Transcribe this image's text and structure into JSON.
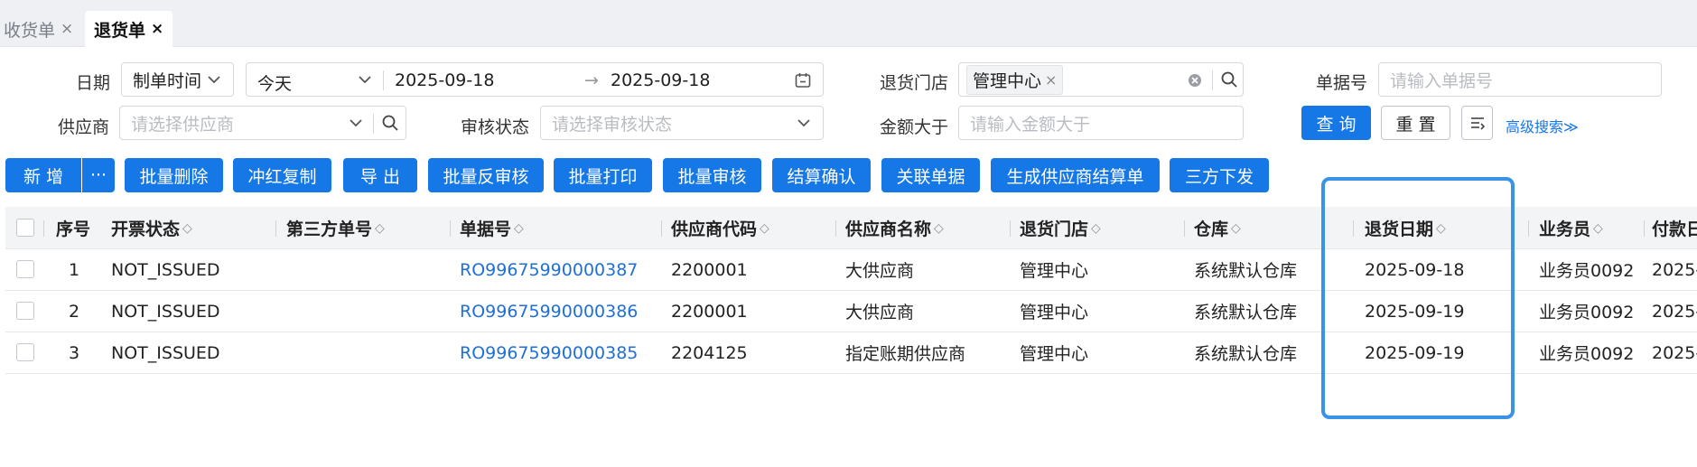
{
  "tabs": [
    {
      "label": "收货单",
      "close": "×"
    },
    {
      "label": "退货单",
      "close": "×"
    }
  ],
  "filters": {
    "date_label": "日期",
    "date_type": "制单时间",
    "date_preset": "今天",
    "date_start": "2025-09-18",
    "date_arrow": "→",
    "date_end": "2025-09-18",
    "store_label": "退货门店",
    "store_tag": "管理中心",
    "store_tag_close": "×",
    "doc_no_label": "单据号",
    "doc_no_placeholder": "请输入单据号",
    "supplier_label": "供应商",
    "supplier_placeholder": "请选择供应商",
    "audit_label": "审核状态",
    "audit_placeholder": "请选择审核状态",
    "amount_label": "金额大于",
    "amount_placeholder": "请输入金额大于",
    "query_label": "查 询",
    "reset_label": "重 置",
    "advanced_label": "高级搜索≫"
  },
  "toolbar": {
    "add": "新 增",
    "more": "···",
    "buttons": [
      "批量删除",
      "冲红复制",
      "导 出",
      "批量反审核",
      "批量打印",
      "批量审核",
      "结算确认",
      "关联单据",
      "生成供应商结算单",
      "三方下发"
    ]
  },
  "table": {
    "headers": [
      "序号",
      "开票状态",
      "第三方单号",
      "单据号",
      "供应商代码",
      "供应商名称",
      "退货门店",
      "仓库",
      "退货日期",
      "业务员",
      "付款日"
    ],
    "sort_icon": "◇",
    "rows": [
      {
        "no": "1",
        "invoice": "NOT_ISSUED",
        "third": "",
        "doc": "RO99675990000387",
        "code": "2200001",
        "name": "大供应商",
        "store": "管理中心",
        "wh": "系统默认仓库",
        "date": "2025-09-18",
        "staff": "业务员0092",
        "pay": "2025-"
      },
      {
        "no": "2",
        "invoice": "NOT_ISSUED",
        "third": "",
        "doc": "RO99675990000386",
        "code": "2200001",
        "name": "大供应商",
        "store": "管理中心",
        "wh": "系统默认仓库",
        "date": "2025-09-19",
        "staff": "业务员0092",
        "pay": "2025-"
      },
      {
        "no": "3",
        "invoice": "NOT_ISSUED",
        "third": "",
        "doc": "RO99675990000385",
        "code": "2204125",
        "name": "指定账期供应商",
        "store": "管理中心",
        "wh": "系统默认仓库",
        "date": "2025-09-19",
        "staff": "业务员0092",
        "pay": "2025-"
      }
    ]
  },
  "colors": {
    "primary": "#1677e6",
    "link": "#1f6fd8",
    "highlight": "#3b93e6"
  }
}
